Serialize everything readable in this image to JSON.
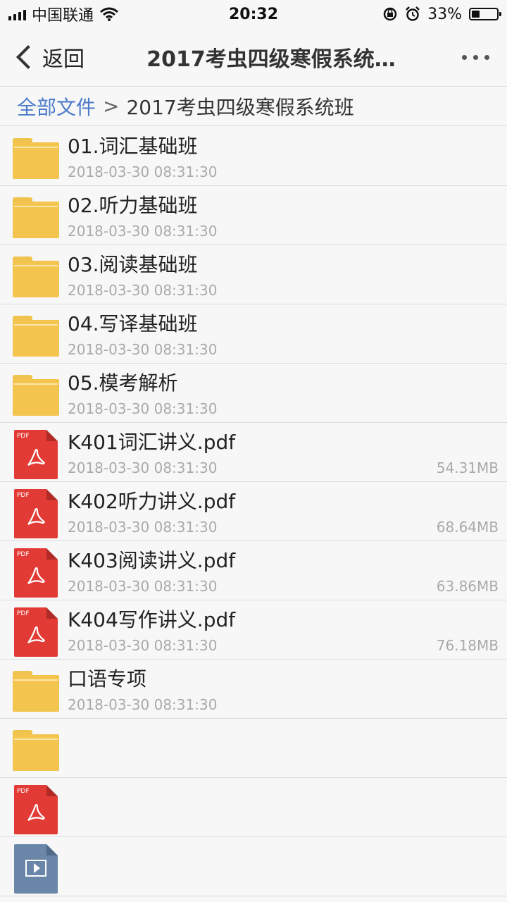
{
  "status_bar": {
    "carrier": "中国联通",
    "time": "20:32",
    "battery_percent": "33%",
    "battery_level": 0.33,
    "icons": [
      "signal-icon",
      "wifi-icon",
      "rotation-lock-icon",
      "alarm-icon",
      "battery-icon"
    ]
  },
  "nav": {
    "back_label": "返回",
    "title": "2017考虫四级寒假系统…"
  },
  "breadcrumb": {
    "root": "全部文件",
    "separator": ">",
    "current": "2017考虫四级寒假系统班"
  },
  "files": [
    {
      "type": "folder",
      "name": "01.词汇基础班",
      "date": "2018-03-30 08:31:30",
      "size": ""
    },
    {
      "type": "folder",
      "name": "02.听力基础班",
      "date": "2018-03-30 08:31:30",
      "size": ""
    },
    {
      "type": "folder",
      "name": "03.阅读基础班",
      "date": "2018-03-30 08:31:30",
      "size": ""
    },
    {
      "type": "folder",
      "name": "04.写译基础班",
      "date": "2018-03-30 08:31:30",
      "size": ""
    },
    {
      "type": "folder",
      "name": "05.模考解析",
      "date": "2018-03-30 08:31:30",
      "size": ""
    },
    {
      "type": "pdf",
      "name": "K401词汇讲义.pdf",
      "date": "2018-03-30 08:31:30",
      "size": "54.31MB"
    },
    {
      "type": "pdf",
      "name": "K402听力讲义.pdf",
      "date": "2018-03-30 08:31:30",
      "size": "68.64MB"
    },
    {
      "type": "pdf",
      "name": "K403阅读讲义.pdf",
      "date": "2018-03-30 08:31:30",
      "size": "63.86MB"
    },
    {
      "type": "pdf",
      "name": "K404写作讲义.pdf",
      "date": "2018-03-30 08:31:30",
      "size": "76.18MB"
    },
    {
      "type": "folder",
      "name": "口语专项",
      "date": "2018-03-30 08:31:30",
      "size": ""
    },
    {
      "type": "folder",
      "name": "",
      "date": "",
      "size": ""
    },
    {
      "type": "pdf",
      "name": "",
      "date": "",
      "size": ""
    },
    {
      "type": "video",
      "name": "",
      "date": "",
      "size": ""
    }
  ],
  "pdf_icon_label": "PDF",
  "colors": {
    "link": "#4a7ac9",
    "folder": "#f3c54f",
    "pdf": "#e23b36",
    "video": "#6a86a8"
  }
}
